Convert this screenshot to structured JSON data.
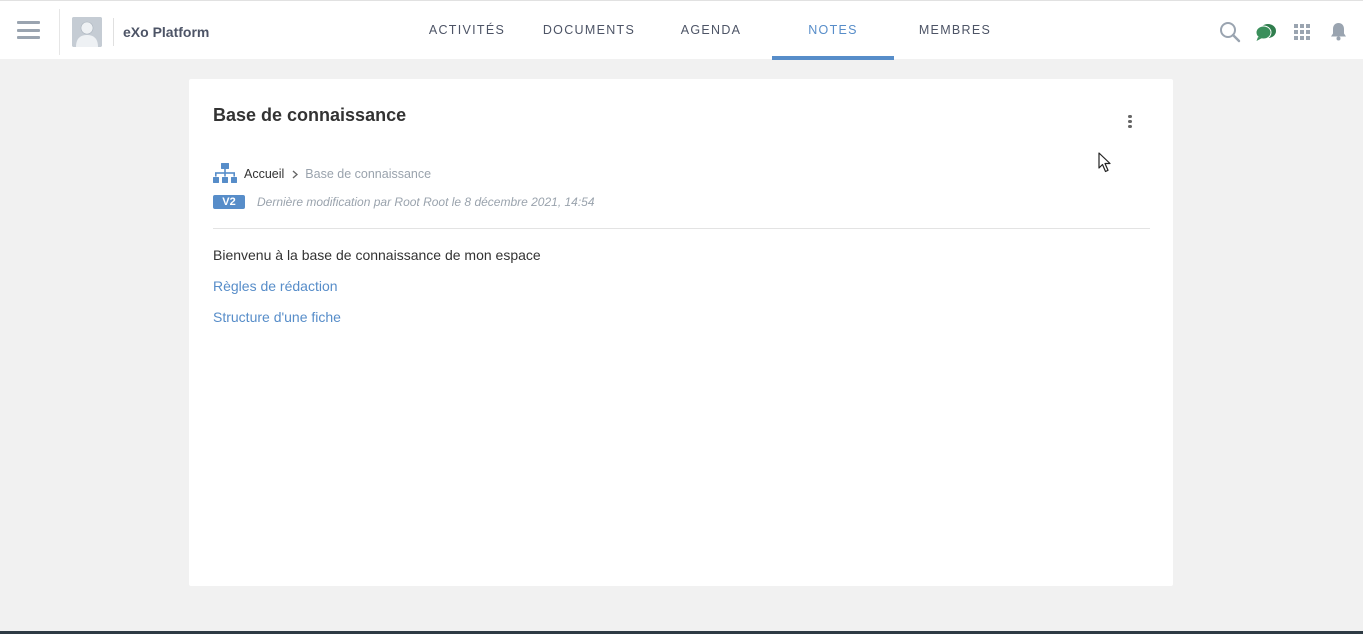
{
  "topbar": {
    "space_name": "eXo Platform",
    "tabs": [
      {
        "label": "ACTIVITÉS",
        "active": false
      },
      {
        "label": "DOCUMENTS",
        "active": false
      },
      {
        "label": "AGENDA",
        "active": false
      },
      {
        "label": "NOTES",
        "active": true
      },
      {
        "label": "MEMBRES",
        "active": false
      }
    ],
    "icons": [
      "search-icon",
      "chat-icon",
      "apps-grid-icon",
      "notifications-bell-icon"
    ]
  },
  "note": {
    "title": "Base de connaissance",
    "breadcrumb": {
      "home": "Accueil",
      "current": "Base de connaissance"
    },
    "version": "V2",
    "last_modified": "Dernière modification par Root Root le 8 décembre 2021, 14:54",
    "body": {
      "intro": "Bienvenu à la base de connaissance de mon espace",
      "links": [
        "Règles de rédaction",
        "Structure d'une fiche"
      ]
    }
  },
  "colors": {
    "accent": "#578dc9",
    "chat_green": "#2f7d4d",
    "background": "#f1f1f1"
  }
}
